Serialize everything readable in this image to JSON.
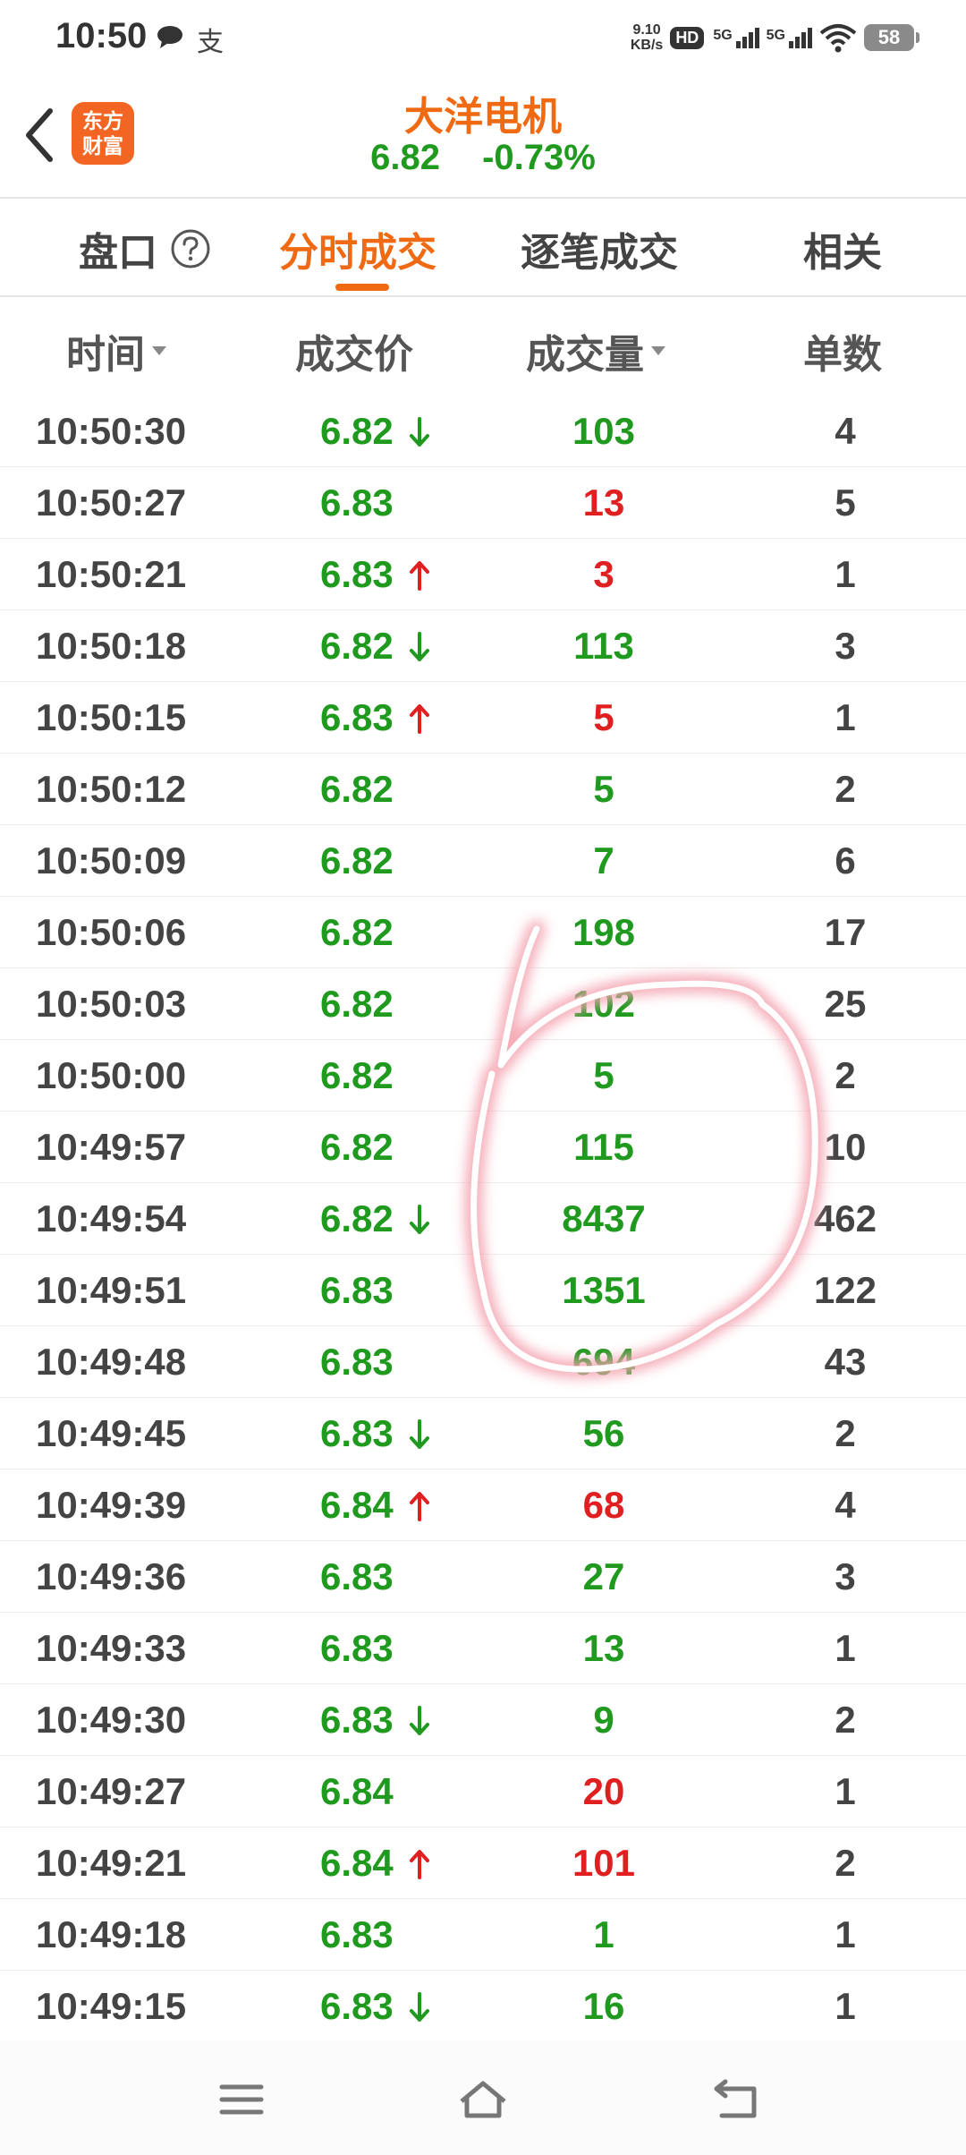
{
  "status_bar": {
    "time": "10:50",
    "alipay_glyph": "支",
    "net_speed_value": "9.10",
    "net_speed_unit": "KB/s",
    "hd_label": "HD",
    "sim1_label": "5G",
    "sim2_label": "5G",
    "battery": "58"
  },
  "header": {
    "logo_line1": "东方",
    "logo_line2": "财富",
    "stock_name": "大洋电机",
    "price": "6.82",
    "change": "-0.73%"
  },
  "tabs": [
    {
      "label": "盘口"
    },
    {
      "label": "分时成交"
    },
    {
      "label": "逐笔成交"
    },
    {
      "label": "相关"
    }
  ],
  "columns": {
    "time": "时间",
    "price": "成交价",
    "volume": "成交量",
    "count": "单数"
  },
  "colors": {
    "accent": "#ef6a12",
    "down_green": "#1f9a1f",
    "up_red": "#e02020"
  },
  "rows": [
    {
      "time": "10:50:30",
      "price": "6.82",
      "arrow": "down",
      "volume": "103",
      "vol_color": "green",
      "count": "4"
    },
    {
      "time": "10:50:27",
      "price": "6.83",
      "arrow": "",
      "volume": "13",
      "vol_color": "red",
      "count": "5"
    },
    {
      "time": "10:50:21",
      "price": "6.83",
      "arrow": "up",
      "volume": "3",
      "vol_color": "red",
      "count": "1"
    },
    {
      "time": "10:50:18",
      "price": "6.82",
      "arrow": "down",
      "volume": "113",
      "vol_color": "green",
      "count": "3"
    },
    {
      "time": "10:50:15",
      "price": "6.83",
      "arrow": "up",
      "volume": "5",
      "vol_color": "red",
      "count": "1"
    },
    {
      "time": "10:50:12",
      "price": "6.82",
      "arrow": "",
      "volume": "5",
      "vol_color": "green",
      "count": "2"
    },
    {
      "time": "10:50:09",
      "price": "6.82",
      "arrow": "",
      "volume": "7",
      "vol_color": "green",
      "count": "6"
    },
    {
      "time": "10:50:06",
      "price": "6.82",
      "arrow": "",
      "volume": "198",
      "vol_color": "green",
      "count": "17"
    },
    {
      "time": "10:50:03",
      "price": "6.82",
      "arrow": "",
      "volume": "102",
      "vol_color": "green",
      "count": "25"
    },
    {
      "time": "10:50:00",
      "price": "6.82",
      "arrow": "",
      "volume": "5",
      "vol_color": "green",
      "count": "2"
    },
    {
      "time": "10:49:57",
      "price": "6.82",
      "arrow": "",
      "volume": "115",
      "vol_color": "green",
      "count": "10"
    },
    {
      "time": "10:49:54",
      "price": "6.82",
      "arrow": "down",
      "volume": "8437",
      "vol_color": "green",
      "count": "462"
    },
    {
      "time": "10:49:51",
      "price": "6.83",
      "arrow": "",
      "volume": "1351",
      "vol_color": "green",
      "count": "122"
    },
    {
      "time": "10:49:48",
      "price": "6.83",
      "arrow": "",
      "volume": "694",
      "vol_color": "green",
      "count": "43"
    },
    {
      "time": "10:49:45",
      "price": "6.83",
      "arrow": "down",
      "volume": "56",
      "vol_color": "green",
      "count": "2"
    },
    {
      "time": "10:49:39",
      "price": "6.84",
      "arrow": "up",
      "volume": "68",
      "vol_color": "red",
      "count": "4"
    },
    {
      "time": "10:49:36",
      "price": "6.83",
      "arrow": "",
      "volume": "27",
      "vol_color": "green",
      "count": "3"
    },
    {
      "time": "10:49:33",
      "price": "6.83",
      "arrow": "",
      "volume": "13",
      "vol_color": "green",
      "count": "1"
    },
    {
      "time": "10:49:30",
      "price": "6.83",
      "arrow": "down",
      "volume": "9",
      "vol_color": "green",
      "count": "2"
    },
    {
      "time": "10:49:27",
      "price": "6.84",
      "arrow": "",
      "volume": "20",
      "vol_color": "red",
      "count": "1"
    },
    {
      "time": "10:49:21",
      "price": "6.84",
      "arrow": "up",
      "volume": "101",
      "vol_color": "red",
      "count": "2"
    },
    {
      "time": "10:49:18",
      "price": "6.83",
      "arrow": "",
      "volume": "1",
      "vol_color": "green",
      "count": "1"
    },
    {
      "time": "10:49:15",
      "price": "6.83",
      "arrow": "down",
      "volume": "16",
      "vol_color": "green",
      "count": "1"
    }
  ],
  "nav": {
    "menu_icon": "menu-icon",
    "home_icon": "home-icon",
    "back_icon": "back-nav-icon"
  }
}
